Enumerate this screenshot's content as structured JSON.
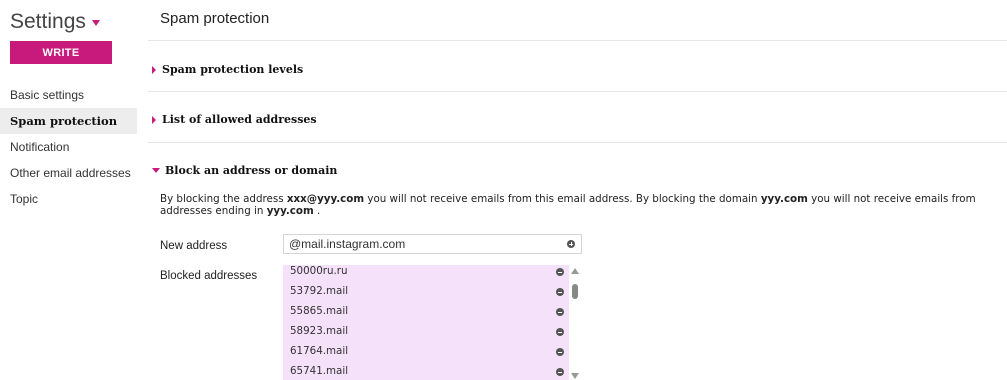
{
  "sidebar": {
    "title": "Settings",
    "write_label": "WRITE",
    "items": [
      {
        "label": "Basic settings",
        "active": false
      },
      {
        "label": "Spam protection",
        "active": true
      },
      {
        "label": "Notification",
        "active": false
      },
      {
        "label": "Other email addresses",
        "active": false
      },
      {
        "label": "Topic",
        "active": false
      }
    ]
  },
  "main": {
    "title": "Spam protection",
    "sections": [
      {
        "label": "Spam protection levels",
        "expanded": false
      },
      {
        "label": "List of allowed addresses",
        "expanded": false
      },
      {
        "label": "Block an address or domain",
        "expanded": true
      }
    ],
    "description": {
      "p1": "By blocking the address ",
      "addr_example": "xxx@yyy.com",
      "p2": " you will not receive emails from this email address. By blocking the domain ",
      "domain_example": "yyy.com",
      "p3": " you will not receive emails from addresses ending in ",
      "domain_example2": "yyy.com",
      "p4": " ."
    },
    "new_address_label": "New address",
    "new_address_value": "@mail.instagram.com",
    "blocked_label": "Blocked addresses",
    "blocked": [
      "50000ru.ru",
      "53792.mail",
      "55865.mail",
      "58923.mail",
      "61764.mail",
      "65741.mail"
    ]
  },
  "colors": {
    "accent": "#c8197c",
    "blocked_list_bg": "#f5e1fa",
    "active_nav_bg": "#ededed"
  }
}
